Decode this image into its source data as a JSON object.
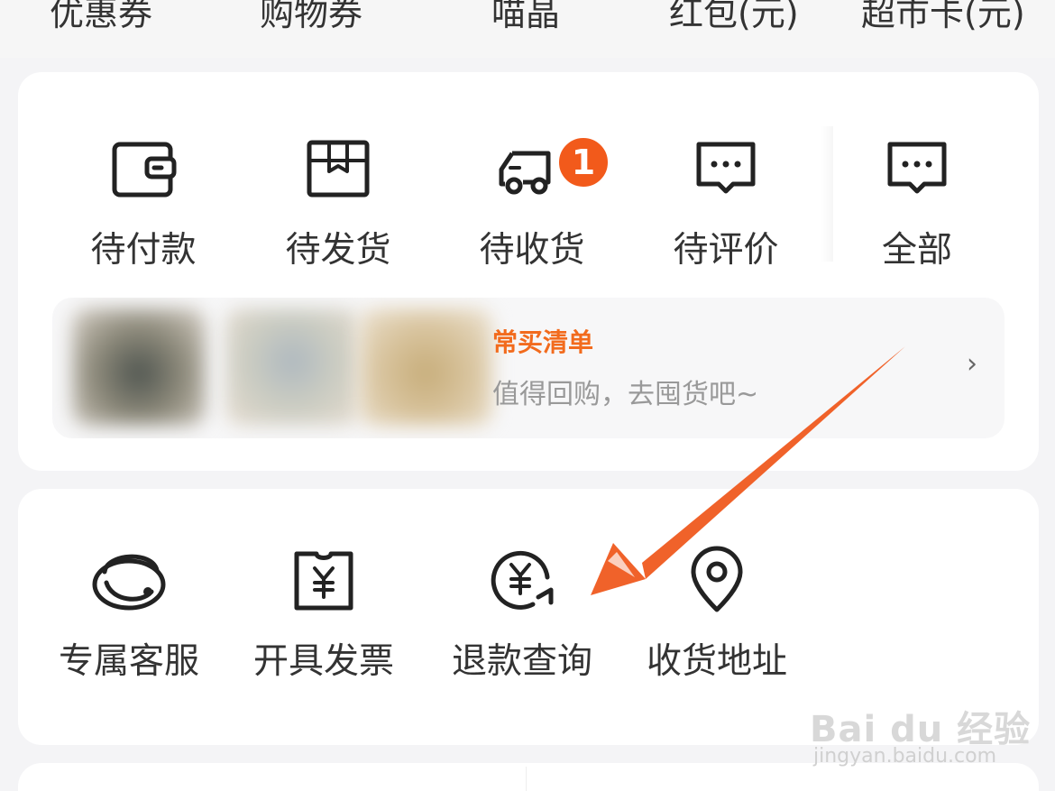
{
  "asset_labels": [
    "优惠券",
    "购物券",
    "喵晶",
    "红包(元)",
    "超市卡(元)"
  ],
  "orders": {
    "items": [
      {
        "label": "待付款",
        "icon": "wallet-icon"
      },
      {
        "label": "待发货",
        "icon": "package-box-icon"
      },
      {
        "label": "待收货",
        "icon": "delivery-truck-icon",
        "badge": "1"
      },
      {
        "label": "待评价",
        "icon": "comment-bubble-icon"
      },
      {
        "label": "全部",
        "icon": "all-orders-icon"
      }
    ]
  },
  "frequent_list": {
    "title": "常买清单",
    "subtitle": "值得回购，去囤货吧~",
    "chevron": "›"
  },
  "services": {
    "items": [
      {
        "label": "专属客服",
        "icon": "customer-service-icon"
      },
      {
        "label": "开具发票",
        "icon": "invoice-icon"
      },
      {
        "label": "退款查询",
        "icon": "refund-query-icon"
      },
      {
        "label": "收货地址",
        "icon": "location-pin-icon"
      }
    ]
  },
  "watermark": {
    "main": "Bai du 经验",
    "sub": "jingyan.baidu.com"
  },
  "colors": {
    "accent": "#f26b1d",
    "badge": "#f25a1b",
    "arrow": "#f0622a",
    "icon_stroke": "#222222"
  }
}
